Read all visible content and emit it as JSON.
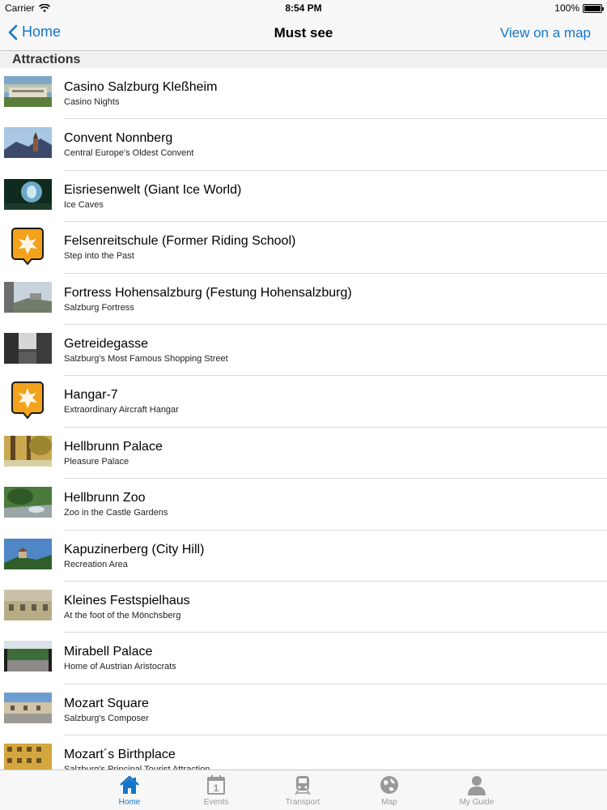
{
  "status": {
    "carrier": "Carrier",
    "time": "8:54 PM",
    "battery": "100%"
  },
  "nav": {
    "back_label": "Home",
    "title": "Must see",
    "right_label": "View on a map"
  },
  "section": {
    "title": "Attractions"
  },
  "items": [
    {
      "title": "Casino Salzburg Kleßheim",
      "subtitle": "Casino Nights",
      "thumb": "photo-palace"
    },
    {
      "title": "Convent Nonnberg",
      "subtitle": "Central Europe's Oldest Convent",
      "thumb": "photo-convent"
    },
    {
      "title": "Eisriesenwelt (Giant Ice World)",
      "subtitle": "Ice Caves",
      "thumb": "photo-ice-cave"
    },
    {
      "title": "Felsenreitschule (Former Riding School)",
      "subtitle": "Step into the Past",
      "thumb": "placeholder-badge-icon"
    },
    {
      "title": "Fortress Hohensalzburg (Festung Hohensalzburg)",
      "subtitle": "Salzburg Fortress",
      "thumb": "photo-fortress"
    },
    {
      "title": "Getreidegasse",
      "subtitle": "Salzburg's Most Famous Shopping Street",
      "thumb": "photo-street"
    },
    {
      "title": "Hangar-7",
      "subtitle": "Extraordinary Aircraft Hangar",
      "thumb": "placeholder-badge-icon"
    },
    {
      "title": "Hellbrunn Palace",
      "subtitle": "Pleasure Palace",
      "thumb": "photo-park"
    },
    {
      "title": "Hellbrunn Zoo",
      "subtitle": "Zoo in the Castle Gardens",
      "thumb": "photo-zoo"
    },
    {
      "title": "Kapuzinerberg (City Hill)",
      "subtitle": "Recreation Area",
      "thumb": "photo-hill"
    },
    {
      "title": "Kleines Festspielhaus",
      "subtitle": "At the foot of the Mönchsberg",
      "thumb": "photo-building"
    },
    {
      "title": "Mirabell Palace",
      "subtitle": "Home of Austrian Aristocrats",
      "thumb": "photo-garden"
    },
    {
      "title": "Mozart Square",
      "subtitle": "Salzburg's Composer",
      "thumb": "photo-square"
    },
    {
      "title": "Mozart´s Birthplace",
      "subtitle": "Salzburg's Principal Tourist Attraction",
      "thumb": "photo-birthplace"
    }
  ],
  "tabs": [
    {
      "label": "Home",
      "icon": "home-icon",
      "active": true
    },
    {
      "label": "Events",
      "icon": "calendar-icon",
      "active": false
    },
    {
      "label": "Transport",
      "icon": "train-icon",
      "active": false
    },
    {
      "label": "Map",
      "icon": "globe-icon",
      "active": false
    },
    {
      "label": "My Guide",
      "icon": "person-icon",
      "active": false
    }
  ],
  "colors": {
    "accent": "#1476c8",
    "badge": "#f3a21b",
    "tab_inactive": "#999999"
  }
}
